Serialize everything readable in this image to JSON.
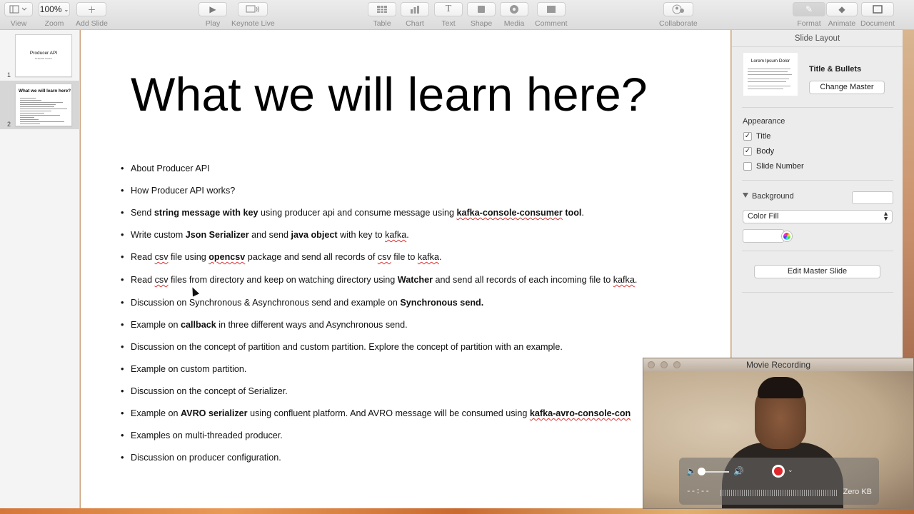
{
  "toolbar": {
    "view": "View",
    "zoom_value": "100%",
    "zoom": "Zoom",
    "add_slide": "Add Slide",
    "play": "Play",
    "keynote_live": "Keynote Live",
    "table": "Table",
    "chart": "Chart",
    "text": "Text",
    "shape": "Shape",
    "media": "Media",
    "comment": "Comment",
    "collaborate": "Collaborate",
    "format": "Format",
    "animate": "Animate",
    "document": "Document"
  },
  "navigator": {
    "slides": [
      {
        "number": "1",
        "title": "Producer API",
        "subtitle": "RHSOND KAFKA"
      },
      {
        "number": "2",
        "title": "What we will learn here?"
      }
    ]
  },
  "slide": {
    "title": "What we will learn here?",
    "bullets": [
      {
        "segments": [
          {
            "t": "About Producer API"
          }
        ]
      },
      {
        "segments": [
          {
            "t": "How Producer API works?"
          }
        ]
      },
      {
        "segments": [
          {
            "t": "Send "
          },
          {
            "t": "string message with key",
            "b": true
          },
          {
            "t": " using producer api and consume message using "
          },
          {
            "t": "kafka-console-consumer",
            "b": true,
            "sq": true
          },
          {
            "t": " tool",
            "b": true
          },
          {
            "t": "."
          }
        ]
      },
      {
        "segments": [
          {
            "t": "Write custom "
          },
          {
            "t": "Json Serializer",
            "b": true
          },
          {
            "t": " and send "
          },
          {
            "t": "java object",
            "b": true
          },
          {
            "t": " with key to "
          },
          {
            "t": "kafka",
            "sq": true
          },
          {
            "t": "."
          }
        ]
      },
      {
        "segments": [
          {
            "t": "Read "
          },
          {
            "t": "csv",
            "sq": true
          },
          {
            "t": " file using "
          },
          {
            "t": "opencsv",
            "b": true,
            "sq": true
          },
          {
            "t": " package and send all records of "
          },
          {
            "t": "csv",
            "sq": true
          },
          {
            "t": " file to "
          },
          {
            "t": "kafka",
            "sq": true
          },
          {
            "t": "."
          }
        ]
      },
      {
        "segments": [
          {
            "t": "Read "
          },
          {
            "t": "csv",
            "sq": true
          },
          {
            "t": " files from directory and keep on watching directory using "
          },
          {
            "t": "Watcher",
            "b": true
          },
          {
            "t": " and send all records of each incoming file to "
          },
          {
            "t": "kafka",
            "sq": true
          },
          {
            "t": "."
          }
        ]
      },
      {
        "segments": [
          {
            "t": "Discussion on Synchronous & Asynchronous send and example on "
          },
          {
            "t": "Synchronous send.",
            "b": true
          }
        ]
      },
      {
        "segments": [
          {
            "t": "Example on "
          },
          {
            "t": "callback",
            "b": true
          },
          {
            "t": " in three different ways and Asynchronous send."
          }
        ]
      },
      {
        "segments": [
          {
            "t": "Discussion on the concept of partition and custom partition.  Explore the concept of partition with an example."
          }
        ]
      },
      {
        "segments": [
          {
            "t": "Example on custom partition."
          }
        ]
      },
      {
        "segments": [
          {
            "t": "Discussion on the concept of Serializer."
          }
        ]
      },
      {
        "segments": [
          {
            "t": "Example on "
          },
          {
            "t": "AVRO serializer",
            "b": true
          },
          {
            "t": " using confluent platform. And AVRO message will be consumed using "
          },
          {
            "t": "kafka-avro-console-con",
            "b": true,
            "sq": true
          }
        ]
      },
      {
        "segments": [
          {
            "t": "Examples on multi-threaded producer."
          }
        ]
      },
      {
        "segments": [
          {
            "t": "Discussion on producer configuration."
          }
        ]
      }
    ]
  },
  "inspector": {
    "header": "Slide Layout",
    "master_thumb_title": "Lorem Ipsum Dolor",
    "master_name": "Title & Bullets",
    "change_master": "Change Master",
    "appearance": "Appearance",
    "checks": [
      {
        "label": "Title",
        "checked": true
      },
      {
        "label": "Body",
        "checked": true
      },
      {
        "label": "Slide Number",
        "checked": false
      }
    ],
    "background": "Background",
    "fill_type": "Color Fill",
    "edit_master": "Edit Master Slide"
  },
  "movie": {
    "title": "Movie Recording",
    "time": "--:--",
    "size": "Zero KB"
  },
  "colors": {
    "record": "#e0262a",
    "squiggle": "#dd3333"
  }
}
